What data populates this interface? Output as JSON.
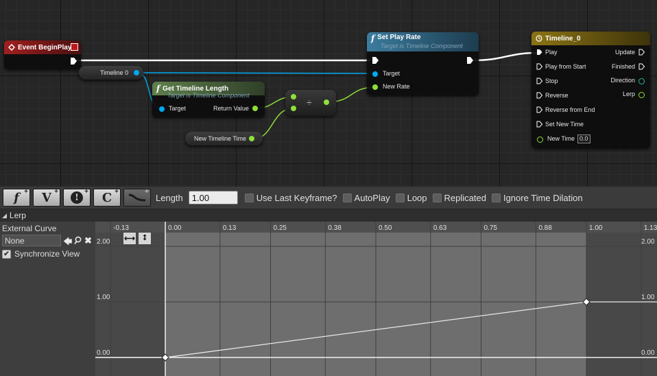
{
  "graph": {
    "event_node": {
      "title": "Event BeginPlay"
    },
    "timeline_var": {
      "label": "Timeline 0"
    },
    "get_length_node": {
      "title": "Get Timeline Length",
      "subtitle": "Target is Timeline Component",
      "pin_target": "Target",
      "pin_return": "Return Value"
    },
    "divide_node": {
      "symbol": "÷"
    },
    "new_time_var": {
      "label": "New Timeline Time"
    },
    "set_rate_node": {
      "title": "Set Play Rate",
      "subtitle": "Target is Timeline Component",
      "pin_target": "Target",
      "pin_new_rate": "New Rate"
    },
    "timeline_node": {
      "title": "Timeline_0",
      "inputs": [
        "Play",
        "Play from Start",
        "Stop",
        "Reverse",
        "Reverse from End",
        "Set New Time",
        "New Time"
      ],
      "new_time_value": "0.0",
      "outputs": [
        "Update",
        "Finished",
        "Direction",
        "Lerp"
      ]
    },
    "colors": {
      "exec": "#ffffff",
      "object": "#00a8f0",
      "float": "#8fe03a",
      "direction": "#27b5a6",
      "event_header": "#8a1a1a",
      "function_header": "#2c5f78",
      "length_header": "#4b6540",
      "timeline_header": "#7a6410"
    }
  },
  "toolbar": {
    "buttons": [
      {
        "glyph": "f",
        "icon": "add-float-track-icon"
      },
      {
        "glyph": "V",
        "icon": "add-vector-track-icon"
      },
      {
        "glyph": "!",
        "icon": "add-event-track-icon"
      },
      {
        "glyph": "C",
        "icon": "add-color-track-icon"
      },
      {
        "glyph": "~",
        "icon": "add-external-curve-icon"
      }
    ],
    "length_label": "Length",
    "length_value": "1.00",
    "checkboxes": [
      "Use Last Keyframe?",
      "AutoPlay",
      "Loop",
      "Replicated",
      "Ignore Time Dilation"
    ]
  },
  "track": {
    "name": "Lerp",
    "external_curve_label": "External Curve",
    "external_curve_value": "None",
    "sync_label": "Synchronize View",
    "sync_checked": true
  },
  "curve_editor": {
    "x_ticks": [
      "-0.13",
      "0.00",
      "0.13",
      "0.25",
      "0.38",
      "0.50",
      "0.63",
      "0.75",
      "0.88",
      "1.00",
      "1.13"
    ],
    "y_ticks": [
      "2.00",
      "1.00",
      "0.00"
    ],
    "keys": [
      {
        "time": 0.0,
        "value": 0.0
      },
      {
        "time": 1.0,
        "value": 1.0
      }
    ]
  }
}
